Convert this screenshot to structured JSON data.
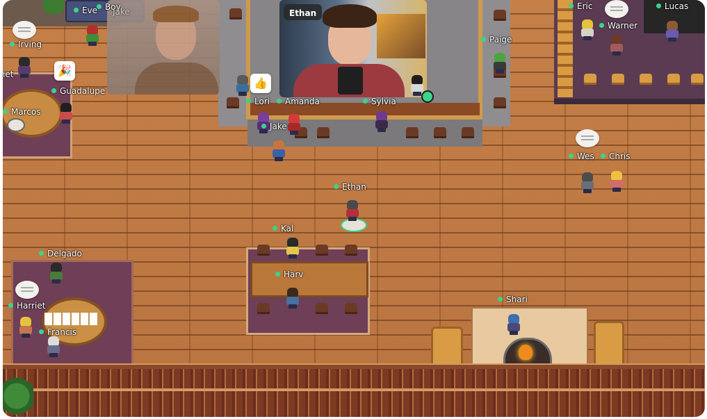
{
  "video_tiles": {
    "main_caller": {
      "name": "Ethan"
    },
    "left_caller": {
      "label": ""
    }
  },
  "players": {
    "irving": "Irving",
    "guadalupe": "Guadalupe",
    "marcos": "Marcos",
    "eve": "Eve",
    "boy": "Boy",
    "jake_top": "Jake",
    "lori": "Lori",
    "amanda": "Amanda",
    "sylvia": "Sylvia",
    "paige": "Paige",
    "jake": "Jake",
    "eric": "Eric",
    "warner": "Warner",
    "lucas": "Lucas",
    "wes": "Wes",
    "chris": "Chris",
    "ethan": "Ethan",
    "kal": "Kal",
    "harv": "Harv",
    "delgado": "Delgado",
    "harriet": "Harriet",
    "francis": "Francis",
    "shari": "Shari",
    "iet": "iet"
  },
  "reactions": {
    "thumbs": "👍",
    "party": "🎉"
  },
  "colors": {
    "online_dot": "#3cd38a",
    "floor": "#c07a45",
    "rug_purple": "#6e3f56",
    "gray_floor": "#8f8d8f"
  }
}
